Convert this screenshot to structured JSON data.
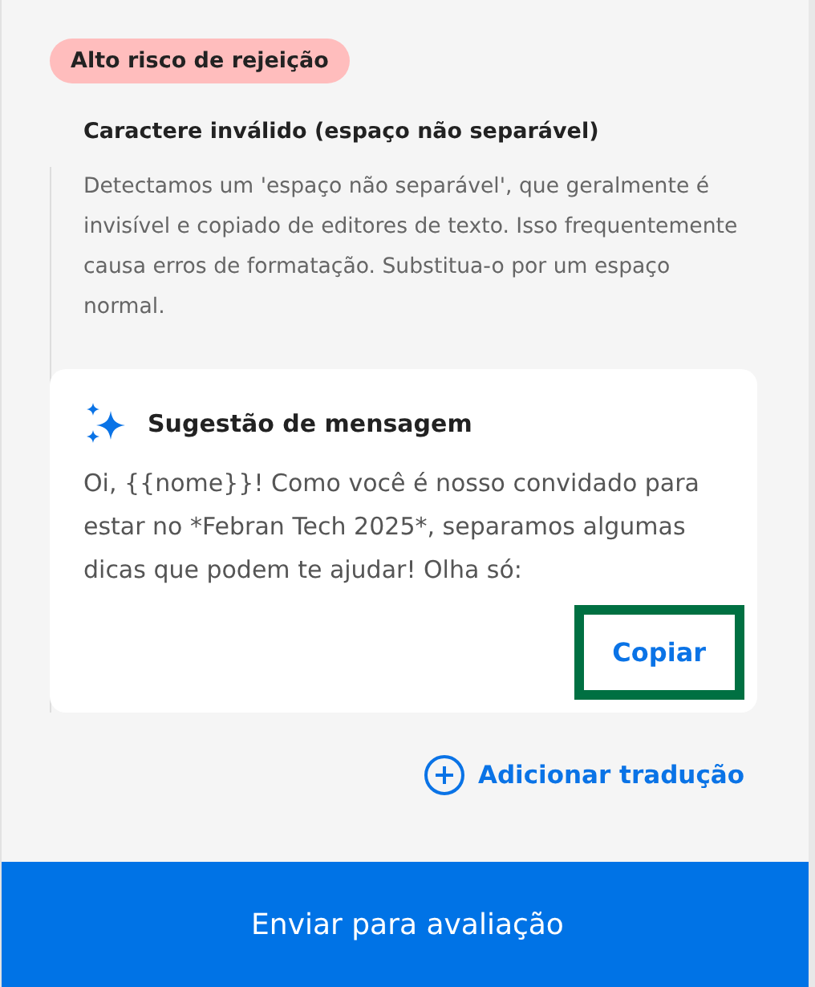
{
  "risk_badge": "Alto risco de rejeição",
  "issue": {
    "title": "Caractere inválido (espaço não separável)",
    "description": "Detectamos um 'espaço não separável', que geralmente é invisível e copiado de editores de texto. Isso frequentemente causa erros de formatação. Substitua-o por um espaço normal."
  },
  "suggestion": {
    "title": "Sugestão de mensagem",
    "message": "Oi, {{nome}}! Como você é nosso convidado para estar no *Febran Tech 2025*, separamos algumas dicas que podem te ajudar! Olha só:",
    "copy_button": {
      "label": "Copiar",
      "highlighted": true
    }
  },
  "add_translation": "Adicionar tradução",
  "submit_button": "Enviar para avaliação"
}
